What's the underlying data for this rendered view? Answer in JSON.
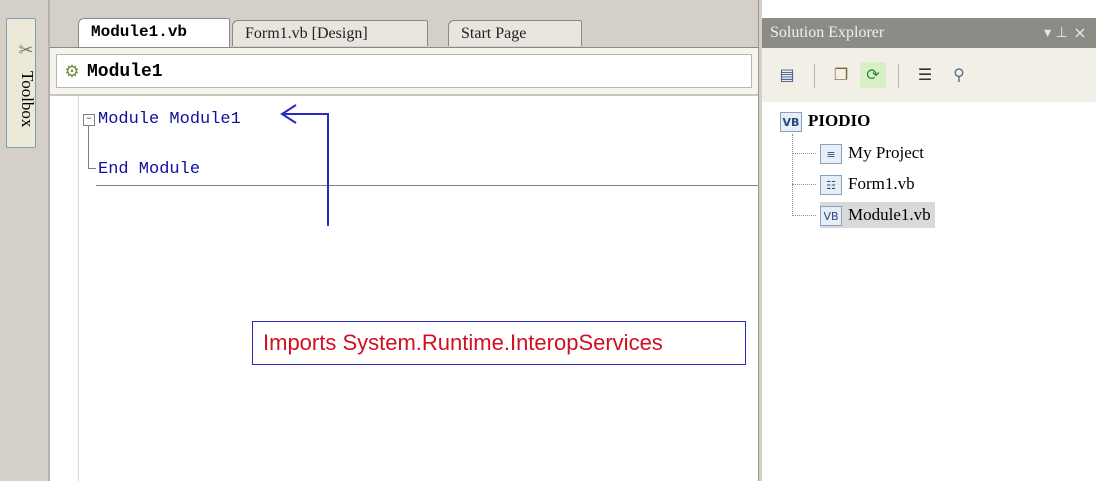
{
  "toolbox": {
    "label": "Toolbox",
    "icon": "toolbox-icon"
  },
  "tabs": [
    {
      "label": "Module1.vb",
      "active": true
    },
    {
      "label": "Form1.vb [Design]",
      "active": false
    },
    {
      "label": "Start Page",
      "active": false
    }
  ],
  "nav": {
    "class_selector": "Module1"
  },
  "editor": {
    "lines": [
      "Module Module1",
      "End Module"
    ],
    "outline_toggle": "−"
  },
  "annotation": {
    "text": "Imports System.Runtime.InteropServices",
    "color": "#d01020",
    "border_color": "#2a2ac0"
  },
  "solution_explorer": {
    "title": "Solution Explorer",
    "pin_glyph": "▾ ⊥",
    "close_glyph": "×",
    "toolbar": [
      "properties-icon",
      "show-all-files-icon",
      "refresh-icon",
      "view-code-icon",
      "class-view-icon"
    ],
    "tree": {
      "project": "PIODIO",
      "items": [
        "My Project",
        "Form1.vb",
        "Module1.vb"
      ],
      "selected": "Module1.vb"
    }
  },
  "colors": {
    "code_keyword": "#1010a0",
    "panel_title_bg": "#8c8b86",
    "chrome_bg": "#d4d0c8"
  }
}
